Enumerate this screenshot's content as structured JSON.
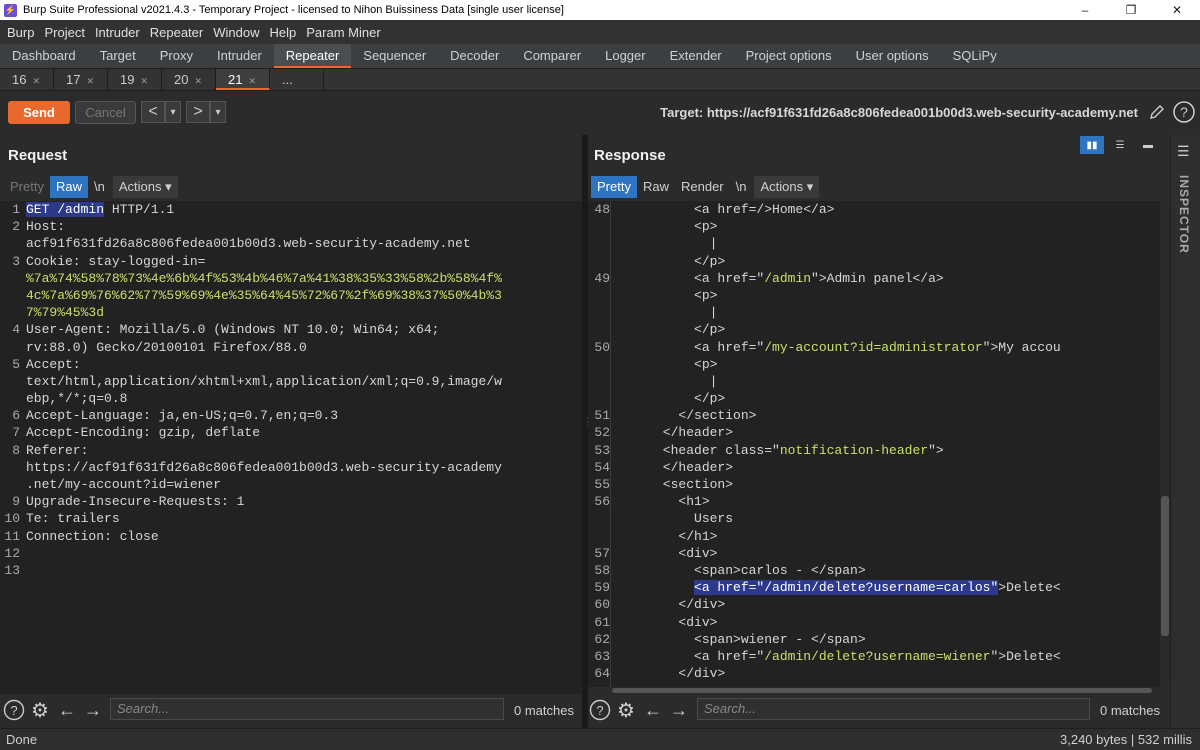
{
  "window": {
    "title": "Burp Suite Professional v2021.4.3 - Temporary Project - licensed to Nihon Buissiness Data [single user license]",
    "minimize": "–",
    "maximize": "❐",
    "close": "✕"
  },
  "menu": [
    "Burp",
    "Project",
    "Intruder",
    "Repeater",
    "Window",
    "Help",
    "Param Miner"
  ],
  "tabs": [
    "Dashboard",
    "Target",
    "Proxy",
    "Intruder",
    "Repeater",
    "Sequencer",
    "Decoder",
    "Comparer",
    "Logger",
    "Extender",
    "Project options",
    "User options",
    "SQLiPy"
  ],
  "active_tab": "Repeater",
  "subtabs": [
    "16",
    "17",
    "19",
    "20",
    "21",
    "..."
  ],
  "active_subtab": "21",
  "toolbar": {
    "send": "Send",
    "cancel": "Cancel",
    "back": "<",
    "back_menu": "▾",
    "forward": ">",
    "forward_menu": "▾",
    "target_label": "Target: https://acf91f631fd26a8c806fedea001b00d3.web-security-academy.net"
  },
  "request": {
    "title": "Request",
    "tabs": {
      "pretty": "Pretty",
      "raw": "Raw",
      "newline": "\\n",
      "actions": "Actions"
    },
    "lines": [
      {
        "n": "1",
        "parts": [
          [
            "hl",
            "GET /admin"
          ],
          [
            "k",
            " HTTP/1.1"
          ]
        ]
      },
      {
        "n": "2",
        "parts": [
          [
            "k",
            "Host:"
          ]
        ]
      },
      {
        "n": "",
        "parts": [
          [
            "k",
            "acf91f631fd26a8c806fedea001b00d3.web-security-academy.net"
          ]
        ]
      },
      {
        "n": "3",
        "parts": [
          [
            "k",
            "Cookie: stay-logged-in="
          ]
        ]
      },
      {
        "n": "",
        "parts": [
          [
            "v",
            "%7a%74%58%78%73%4e%6b%4f%53%4b%46%7a%41%38%35%33%58%2b%58%4f%"
          ]
        ]
      },
      {
        "n": "",
        "parts": [
          [
            "v",
            "4c%7a%69%76%62%77%59%69%4e%35%64%45%72%67%2f%69%38%37%50%4b%3"
          ]
        ]
      },
      {
        "n": "",
        "parts": [
          [
            "v",
            "7%79%45%3d"
          ]
        ]
      },
      {
        "n": "4",
        "parts": [
          [
            "k",
            "User-Agent: Mozilla/5.0 (Windows NT 10.0; Win64; x64;"
          ]
        ]
      },
      {
        "n": "",
        "parts": [
          [
            "k",
            "rv:88.0) Gecko/20100101 Firefox/88.0"
          ]
        ]
      },
      {
        "n": "5",
        "parts": [
          [
            "k",
            "Accept:"
          ]
        ]
      },
      {
        "n": "",
        "parts": [
          [
            "k",
            "text/html,application/xhtml+xml,application/xml;q=0.9,image/w"
          ]
        ]
      },
      {
        "n": "",
        "parts": [
          [
            "k",
            "ebp,*/*;q=0.8"
          ]
        ]
      },
      {
        "n": "6",
        "parts": [
          [
            "k",
            "Accept-Language: ja,en-US;q=0.7,en;q=0.3"
          ]
        ]
      },
      {
        "n": "7",
        "parts": [
          [
            "k",
            "Accept-Encoding: gzip, deflate"
          ]
        ]
      },
      {
        "n": "8",
        "parts": [
          [
            "k",
            "Referer:"
          ]
        ]
      },
      {
        "n": "",
        "parts": [
          [
            "k",
            "https://acf91f631fd26a8c806fedea001b00d3.web-security-academy"
          ]
        ]
      },
      {
        "n": "",
        "parts": [
          [
            "k",
            ".net/my-account?id=wiener"
          ]
        ]
      },
      {
        "n": "9",
        "parts": [
          [
            "k",
            "Upgrade-Insecure-Requests: 1"
          ]
        ]
      },
      {
        "n": "10",
        "parts": [
          [
            "k",
            "Te: trailers"
          ]
        ]
      },
      {
        "n": "11",
        "parts": [
          [
            "k",
            "Connection: close"
          ]
        ]
      },
      {
        "n": "12",
        "parts": []
      },
      {
        "n": "13",
        "parts": []
      }
    ],
    "search_placeholder": "Search...",
    "matches": "0 matches"
  },
  "response": {
    "title": "Response",
    "tabs": {
      "pretty": "Pretty",
      "raw": "Raw",
      "render": "Render",
      "newline": "\\n",
      "actions": "Actions"
    },
    "lines": [
      {
        "n": "48",
        "parts": [
          [
            "k",
            "          <a href=/>Home</a>"
          ]
        ]
      },
      {
        "n": "",
        "parts": [
          [
            "k",
            "          <p>"
          ]
        ]
      },
      {
        "n": "",
        "parts": [
          [
            "k",
            "            |"
          ]
        ]
      },
      {
        "n": "",
        "parts": [
          [
            "k",
            "          </p>"
          ]
        ]
      },
      {
        "n": "49",
        "parts": [
          [
            "k",
            "          <a href=\""
          ],
          [
            "v",
            "/admin"
          ],
          [
            "k",
            "\">Admin panel</a>"
          ]
        ]
      },
      {
        "n": "",
        "parts": [
          [
            "k",
            "          <p>"
          ]
        ]
      },
      {
        "n": "",
        "parts": [
          [
            "k",
            "            |"
          ]
        ]
      },
      {
        "n": "",
        "parts": [
          [
            "k",
            "          </p>"
          ]
        ]
      },
      {
        "n": "50",
        "parts": [
          [
            "k",
            "          <a href=\""
          ],
          [
            "v",
            "/my-account?id=administrator"
          ],
          [
            "k",
            "\">My accou"
          ]
        ]
      },
      {
        "n": "",
        "parts": [
          [
            "k",
            "          <p>"
          ]
        ]
      },
      {
        "n": "",
        "parts": [
          [
            "k",
            "            |"
          ]
        ]
      },
      {
        "n": "",
        "parts": [
          [
            "k",
            "          </p>"
          ]
        ]
      },
      {
        "n": "51",
        "parts": [
          [
            "k",
            "        </section>"
          ]
        ]
      },
      {
        "n": "52",
        "parts": [
          [
            "k",
            "      </header>"
          ]
        ]
      },
      {
        "n": "53",
        "parts": [
          [
            "k",
            "      <header class=\""
          ],
          [
            "v",
            "notification-header"
          ],
          [
            "k",
            "\">"
          ]
        ]
      },
      {
        "n": "54",
        "parts": [
          [
            "k",
            "      </header>"
          ]
        ]
      },
      {
        "n": "55",
        "parts": [
          [
            "k",
            "      <section>"
          ]
        ]
      },
      {
        "n": "56",
        "parts": [
          [
            "k",
            "        <h1>"
          ]
        ]
      },
      {
        "n": "",
        "parts": [
          [
            "k",
            "          Users"
          ]
        ]
      },
      {
        "n": "",
        "parts": [
          [
            "k",
            "        </h1>"
          ]
        ]
      },
      {
        "n": "57",
        "parts": [
          [
            "k",
            "        <div>"
          ]
        ]
      },
      {
        "n": "58",
        "parts": [
          [
            "k",
            "          <span>carlos - </span>"
          ]
        ]
      },
      {
        "n": "59",
        "parts": [
          [
            "k",
            "          "
          ],
          [
            "hl",
            "<a href=\"/admin/delete?username=carlos\""
          ],
          [
            "k",
            ">Delete<"
          ]
        ]
      },
      {
        "n": "60",
        "parts": [
          [
            "k",
            "        </div>"
          ]
        ]
      },
      {
        "n": "61",
        "parts": [
          [
            "k",
            "        <div>"
          ]
        ]
      },
      {
        "n": "62",
        "parts": [
          [
            "k",
            "          <span>wiener - </span>"
          ]
        ]
      },
      {
        "n": "63",
        "parts": [
          [
            "k",
            "          <a href=\""
          ],
          [
            "v",
            "/admin/delete?username=wiener"
          ],
          [
            "k",
            "\">Delete<"
          ]
        ]
      },
      {
        "n": "64",
        "parts": [
          [
            "k",
            "        </div>"
          ]
        ]
      }
    ],
    "search_placeholder": "Search...",
    "matches": "0 matches"
  },
  "inspector_label": "INSPECTOR",
  "status": {
    "left": "Done",
    "right": "3,240 bytes | 532 millis"
  }
}
